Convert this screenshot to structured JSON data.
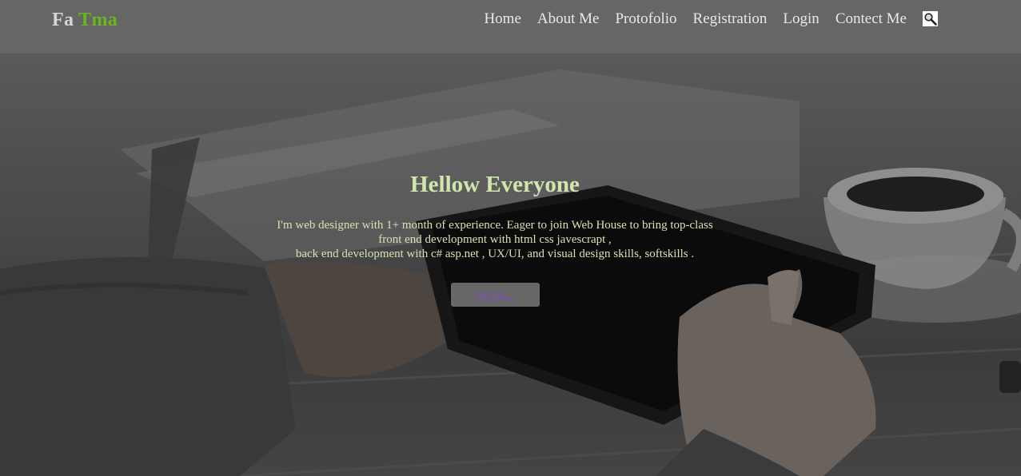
{
  "brand": {
    "first": "Fa",
    "second": "Tma",
    "first_color": "#d6d6d6",
    "second_color": "#6ab520"
  },
  "nav": {
    "items": [
      {
        "label": "Home"
      },
      {
        "label": "About Me"
      },
      {
        "label": "Protofolio"
      },
      {
        "label": "Registration"
      },
      {
        "label": "Login"
      },
      {
        "label": "Contect Me"
      }
    ],
    "search_icon": "search-icon"
  },
  "hero": {
    "title": "Hellow Everyone",
    "lines": [
      "I'm web designer with 1+ month of experience. Eager to join Web House to bring top-class",
      "front end development with html css javescrapt ,",
      "back end development with c# asp.net , UX/UI, and visual design skills, softskills ."
    ],
    "more_label": "more...",
    "accent_color": "#cfe7ad",
    "link_color": "#7f4fb3"
  },
  "colors": {
    "header_bg": "#666666",
    "nav_text": "#e9e9e9"
  }
}
